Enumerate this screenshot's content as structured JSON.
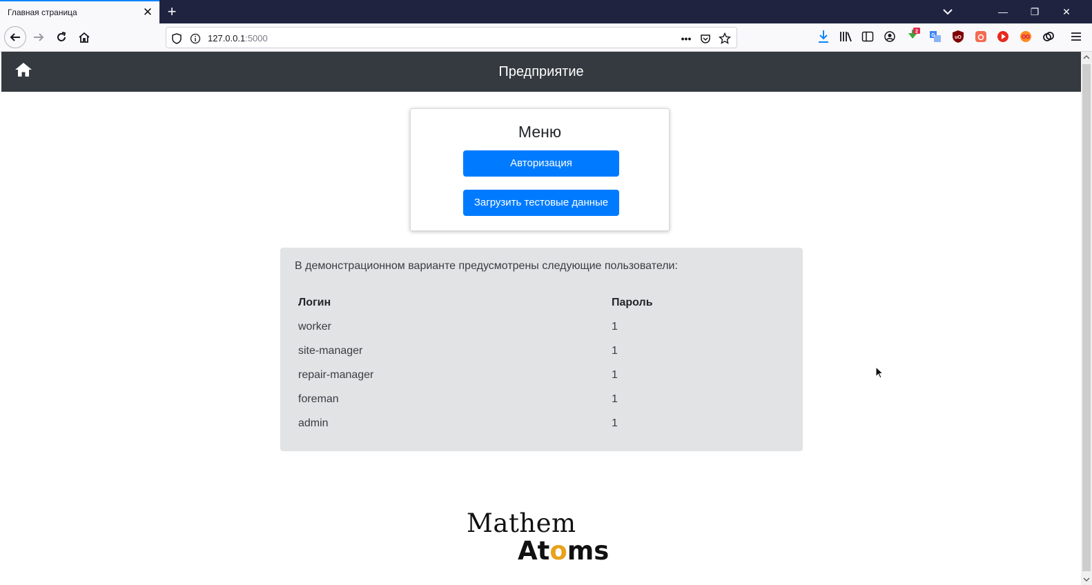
{
  "browser": {
    "tab_title": "Главная страница",
    "url_host": "127.0.0.1",
    "url_port": ":5000"
  },
  "header": {
    "title": "Предприятие"
  },
  "menu": {
    "title": "Меню",
    "login_button": "Авторизация",
    "load_test_data_button": "Загрузить тестовые данные"
  },
  "users": {
    "intro": "В демонстрационном варианте предусмотрены следующие пользователи:",
    "columns": [
      "Логин",
      "Пароль"
    ],
    "rows": [
      {
        "login": "worker",
        "password": "1"
      },
      {
        "login": "site-manager",
        "password": "1"
      },
      {
        "login": "repair-manager",
        "password": "1"
      },
      {
        "login": "foreman",
        "password": "1"
      },
      {
        "login": "admin",
        "password": "1"
      }
    ]
  },
  "logo": {
    "line1": "Mathem",
    "line2_a": "At",
    "line2_o": "o",
    "line2_b": "ms"
  },
  "colors": {
    "header_bg": "#343a40",
    "primary_button": "#007bff",
    "users_box_bg": "#e2e3e5",
    "tabbar_bg": "#202340",
    "logo_accent": "#e8a21c"
  },
  "icons": {
    "header_home": "home-icon",
    "browser_back": "arrow-left-icon",
    "browser_forward": "arrow-right-icon",
    "browser_reload": "reload-icon",
    "browser_home": "home-icon"
  }
}
